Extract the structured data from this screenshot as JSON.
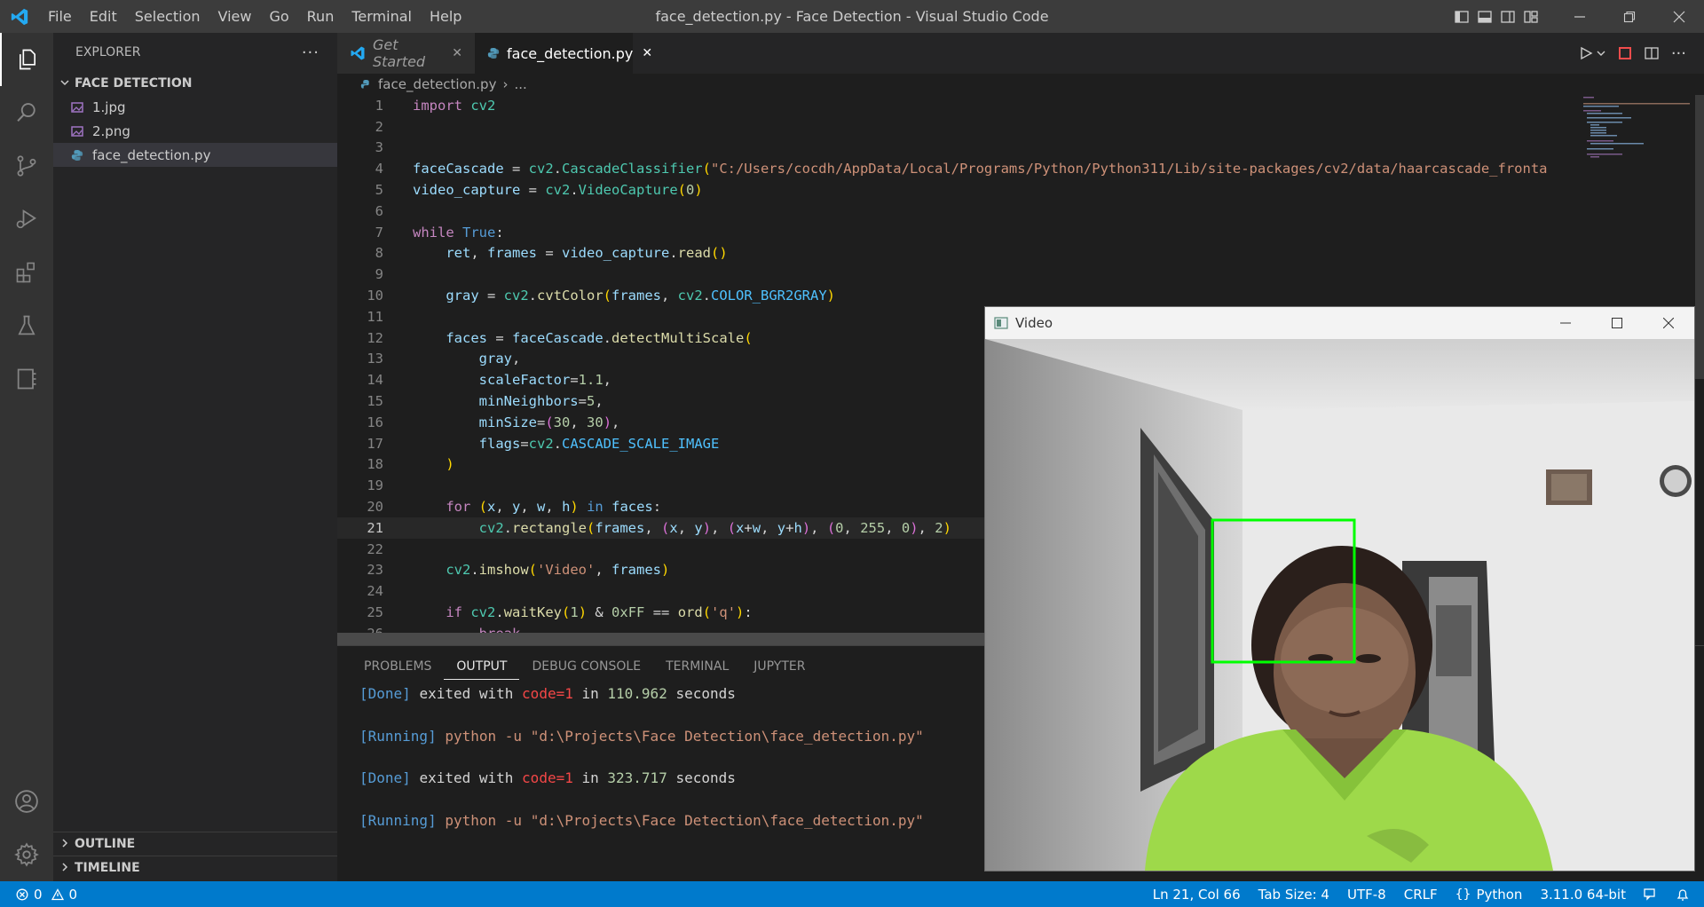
{
  "window": {
    "title": "face_detection.py - Face Detection - Visual Studio Code",
    "menu": [
      "File",
      "Edit",
      "Selection",
      "View",
      "Go",
      "Run",
      "Terminal",
      "Help"
    ]
  },
  "explorer": {
    "header": "EXPLORER",
    "more": "···",
    "folder": "FACE DETECTION",
    "files": [
      {
        "name": "1.jpg",
        "icon": "image-file-icon"
      },
      {
        "name": "2.png",
        "icon": "image-file-icon"
      },
      {
        "name": "face_detection.py",
        "icon": "python-file-icon"
      }
    ],
    "outline": "OUTLINE",
    "timeline": "TIMELINE"
  },
  "tabs": {
    "get_started": "Get Started",
    "face_detection": "face_detection.py",
    "close": "✕"
  },
  "breadcrumb": {
    "file": "face_detection.py",
    "sep": "›",
    "rest": "..."
  },
  "code": {
    "line_numbers": [
      "1",
      "2",
      "3",
      "4",
      "5",
      "6",
      "7",
      "8",
      "9",
      "10",
      "11",
      "12",
      "13",
      "14",
      "15",
      "16",
      "17",
      "18",
      "19",
      "20",
      "21",
      "22",
      "23",
      "24",
      "25",
      "26"
    ],
    "cascade_path": "\"C:/Users/cocdh/AppData/Local/Programs/Python/Python311/Lib/site-packages/cv2/data/haarcascade_fronta",
    "window_name": "'Video'",
    "quit_key": "'q'"
  },
  "panel": {
    "tabs": [
      "PROBLEMS",
      "OUTPUT",
      "DEBUG CONSOLE",
      "TERMINAL",
      "JUPYTER"
    ],
    "active_tab": "OUTPUT",
    "output": {
      "running_tag": "[Running]",
      "done_tag": "[Done]",
      "command": "python -u",
      "script_path": "\"d:\\Projects\\Face Detection\\face_detection.py\"",
      "exited": "exited with",
      "code": "code=1",
      "in": "in",
      "run1_seconds": "110.962",
      "run2_seconds": "323.717",
      "seconds": "seconds"
    }
  },
  "video_window": {
    "title": "Video"
  },
  "statusbar": {
    "errors": "0",
    "warnings": "0",
    "position": "Ln 21, Col 66",
    "tab_size": "Tab Size: 4",
    "encoding": "UTF-8",
    "eol": "CRLF",
    "language": "Python",
    "interpreter": "3.11.0 64-bit"
  },
  "colors": {
    "accent": "#007acc",
    "face_box": "#00ff00",
    "shirt": "#9ed94a"
  }
}
